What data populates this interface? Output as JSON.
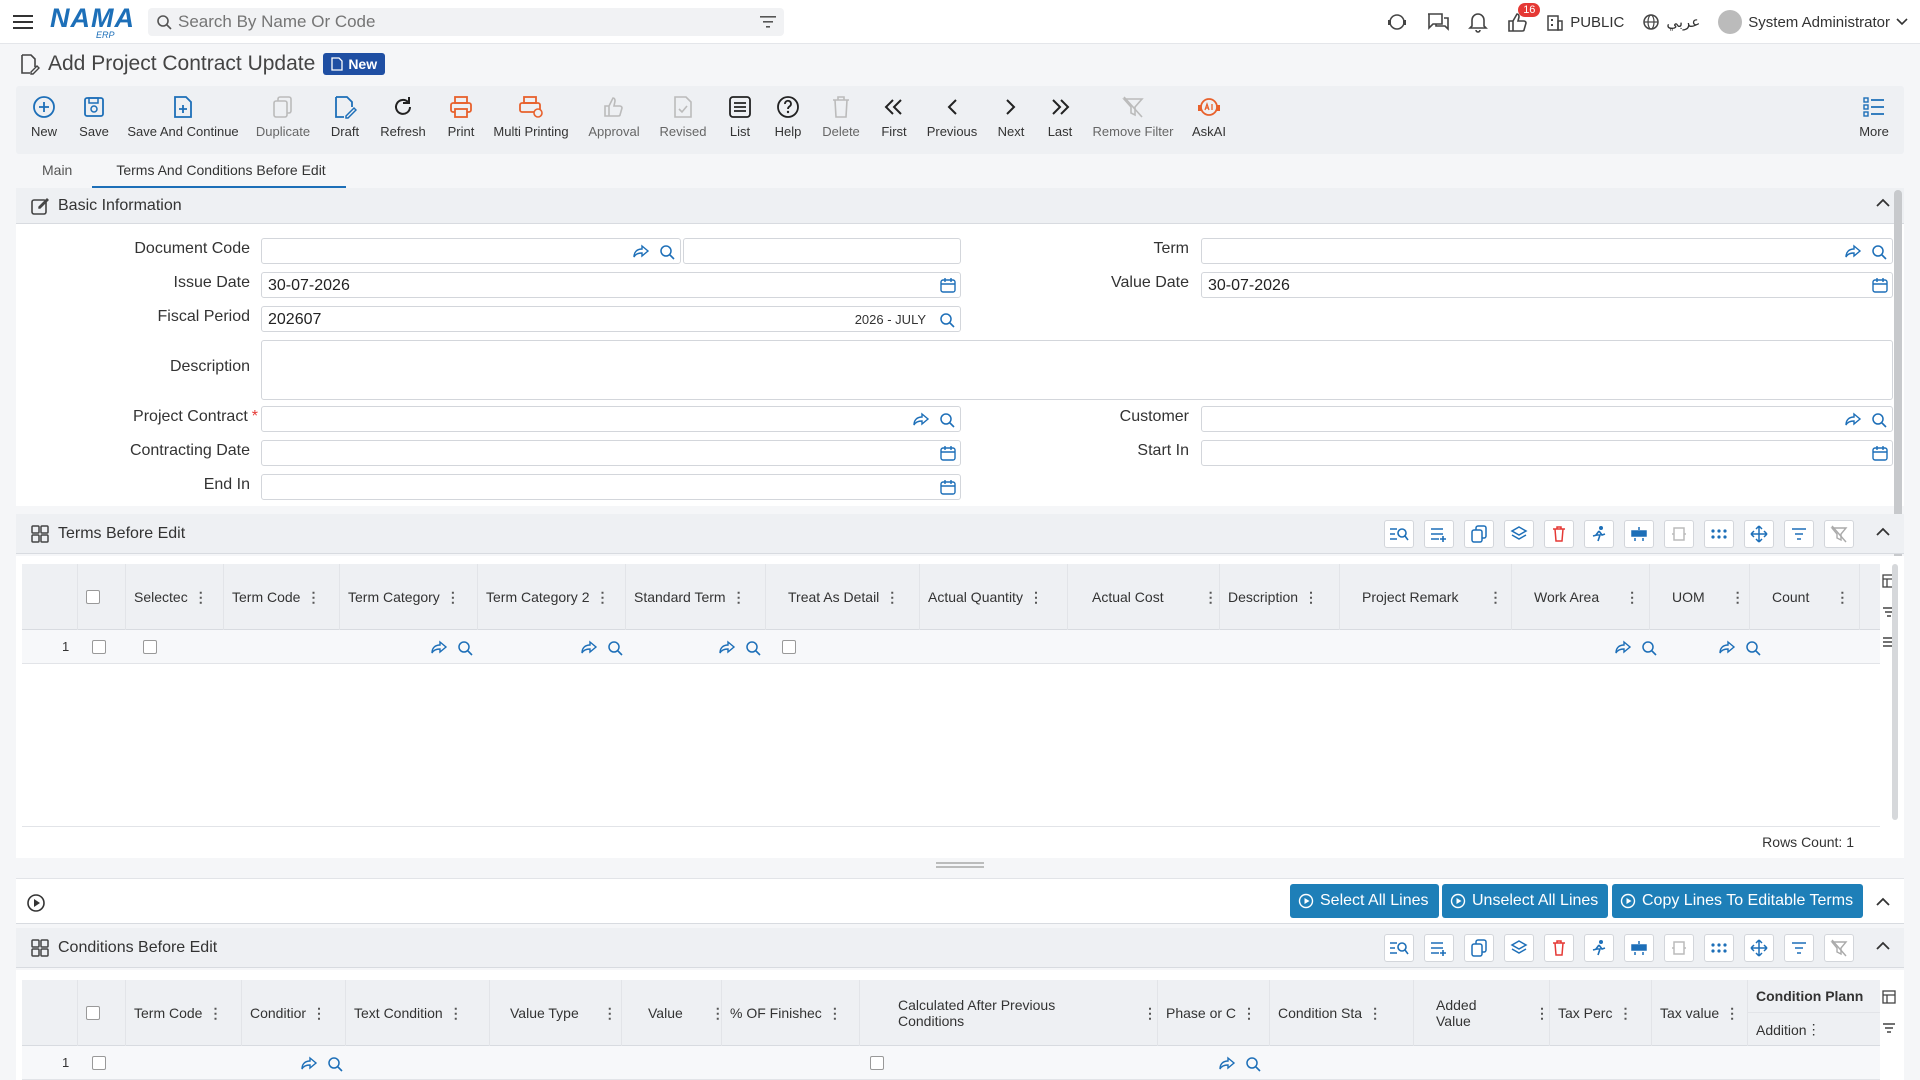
{
  "header": {
    "logo_main": "NAMA",
    "logo_sub": "ERP",
    "search_placeholder": "Search By Name Or Code",
    "notification_count": "16",
    "public_label": "PUBLIC",
    "language_label": "عربي",
    "user_name": "System Administrator"
  },
  "page": {
    "title": "Add Project Contract Update",
    "status_badge": "New"
  },
  "toolbar": {
    "new": "New",
    "save": "Save",
    "save_continue": "Save And Continue",
    "duplicate": "Duplicate",
    "draft": "Draft",
    "refresh": "Refresh",
    "print": "Print",
    "multi_printing": "Multi Printing",
    "approval": "Approval",
    "revised": "Revised",
    "list": "List",
    "help": "Help",
    "delete": "Delete",
    "first": "First",
    "previous": "Previous",
    "next": "Next",
    "last": "Last",
    "remove_filter": "Remove Filter",
    "askai": "AskAI",
    "more": "More"
  },
  "tabs": [
    "Main",
    "Terms And Conditions Before Edit"
  ],
  "basic_info": {
    "title": "Basic Information",
    "document_code_label": "Document Code",
    "document_code": "",
    "term_label": "Term",
    "term": "",
    "issue_date_label": "Issue Date",
    "issue_date": "30-07-2026",
    "value_date_label": "Value Date",
    "value_date": "30-07-2026",
    "fiscal_period_label": "Fiscal Period",
    "fiscal_period": "202607",
    "fiscal_period_hint": "2026 - JULY",
    "description_label": "Description",
    "description": "",
    "project_contract_label": "Project Contract",
    "required_mark": "*",
    "project_contract": "",
    "customer_label": "Customer",
    "customer": "",
    "contracting_date_label": "Contracting Date",
    "contracting_date": "",
    "start_in_label": "Start In",
    "start_in": "",
    "end_in_label": "End In",
    "end_in": ""
  },
  "terms_grid": {
    "title": "Terms Before Edit",
    "columns": [
      "Selectec",
      "Term Code",
      "Term Category",
      "Term Category 2",
      "Standard Term",
      "Treat As Detail",
      "Actual Quantity",
      "Actual Cost",
      "Description",
      "Project Remark",
      "Work Area",
      "UOM",
      "Count"
    ],
    "row_number": "1",
    "rows_count": "Rows Count: 1"
  },
  "actions": {
    "select_all": "Select All Lines",
    "unselect_all": "Unselect All Lines",
    "copy_lines": "Copy Lines To Editable Terms"
  },
  "conditions_grid": {
    "title": "Conditions Before Edit",
    "columns": [
      "Term Code",
      "Conditior",
      "Text Condition",
      "Value Type",
      "Value",
      "% OF Finishec",
      "Calculated After Previous Conditions",
      "Phase or C",
      "Condition Sta",
      "Added Value",
      "Tax Perc",
      "Tax value"
    ],
    "group_header": "Condition Plann",
    "sub_header": "Addition",
    "row_number": "1"
  }
}
